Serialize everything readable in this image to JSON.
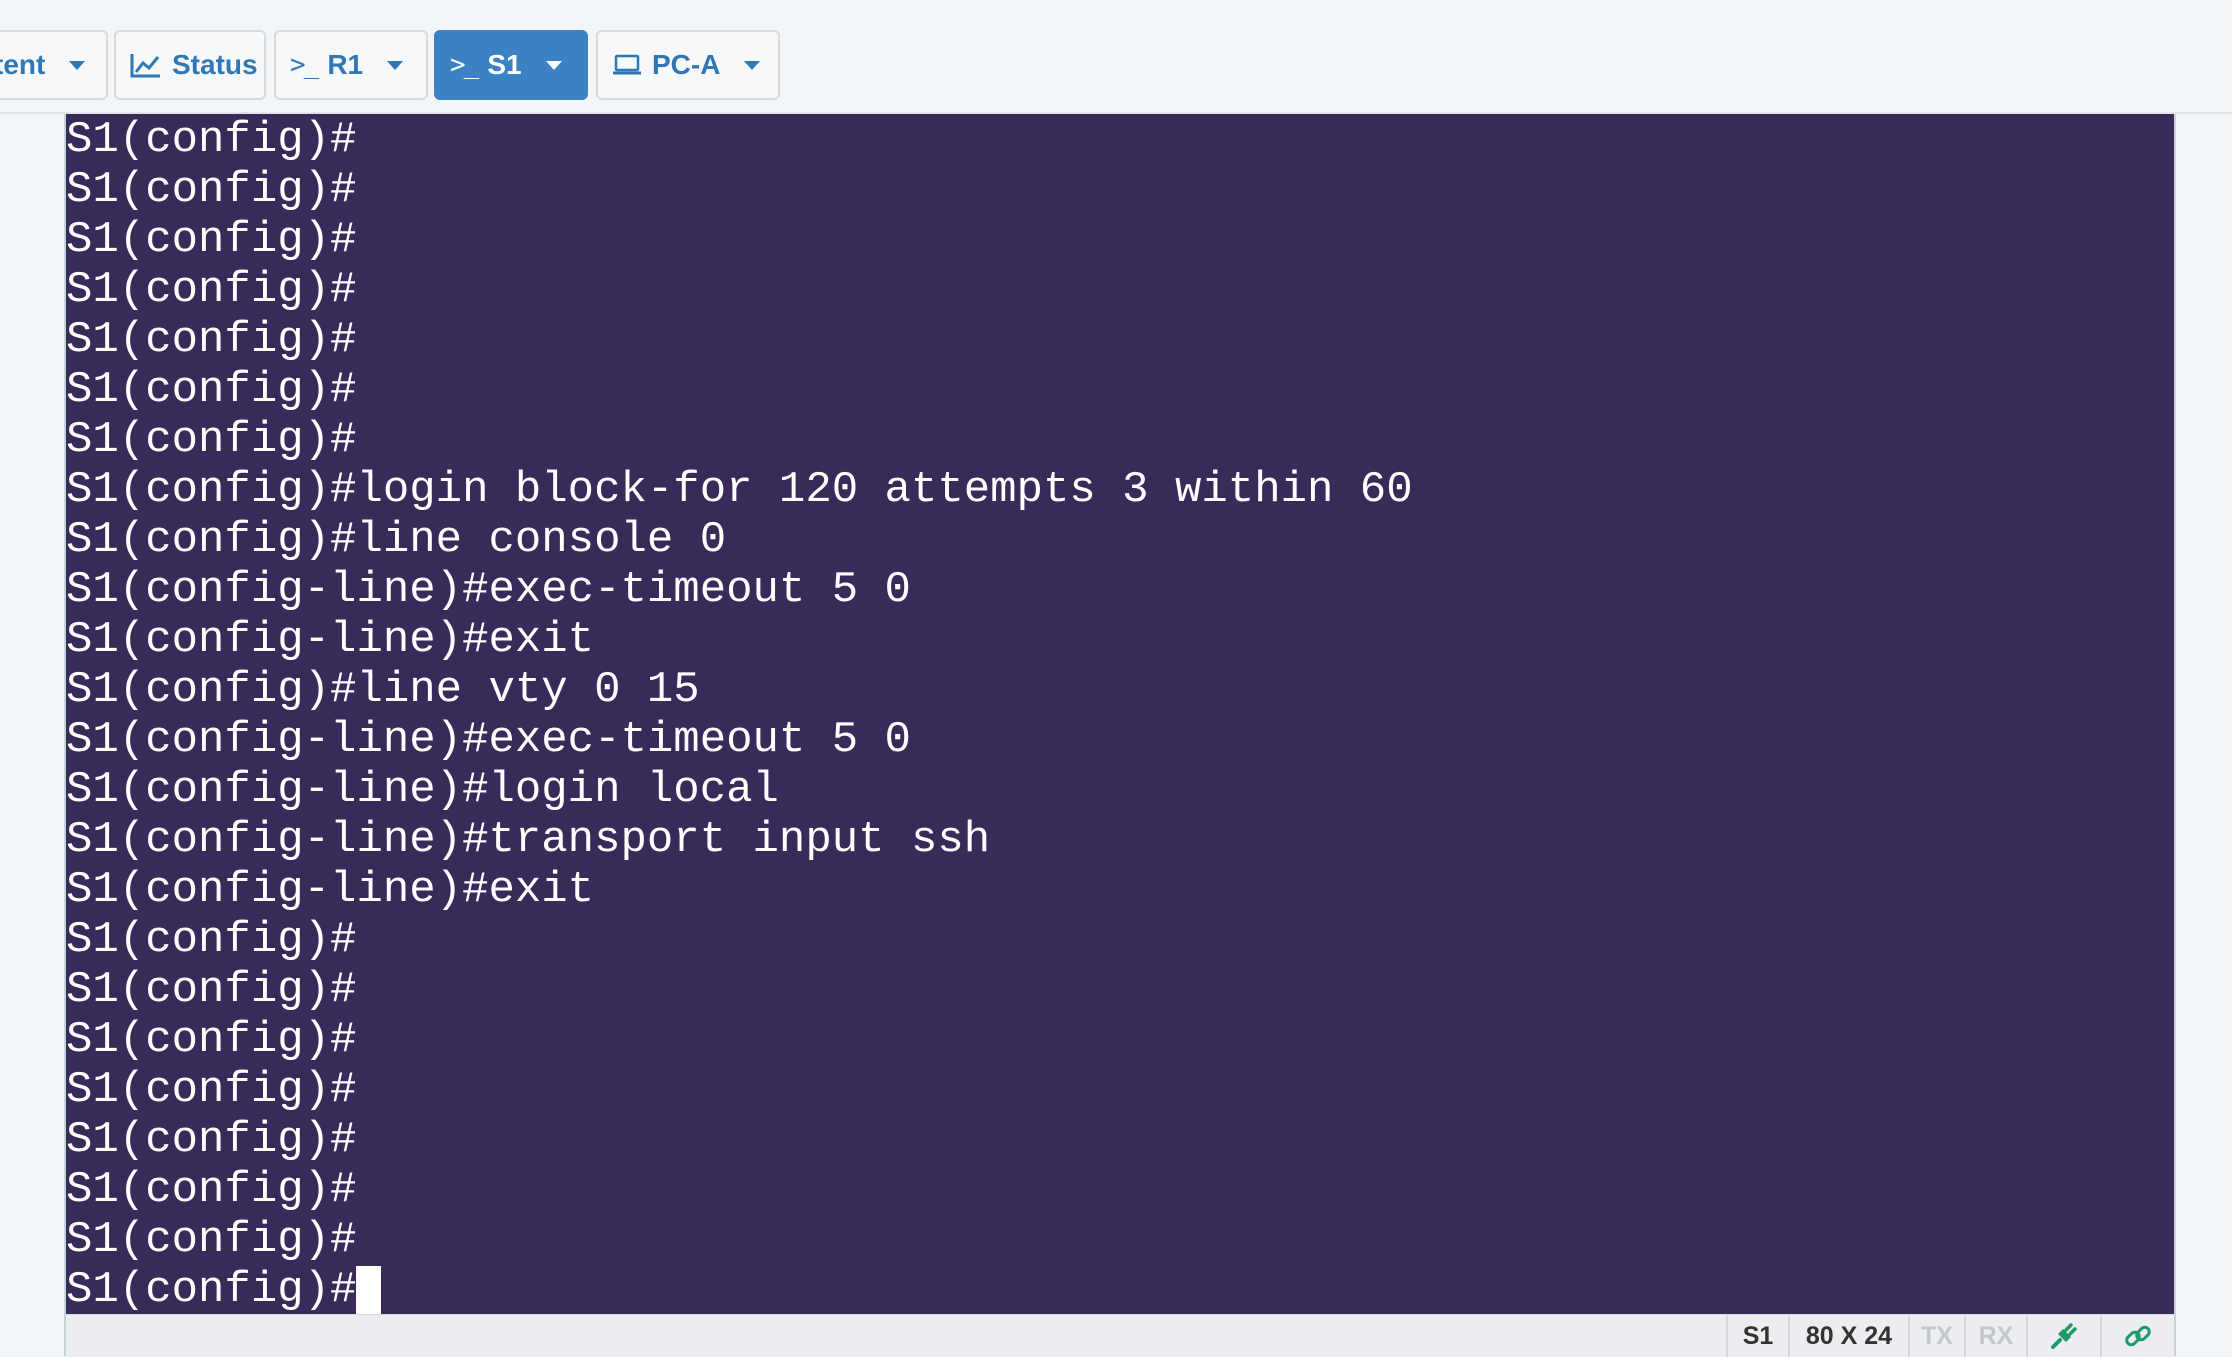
{
  "tabs": [
    {
      "label": "tent",
      "icon": "content-icon"
    },
    {
      "label": "Status",
      "icon": "chart-line-icon"
    },
    {
      "label": "R1",
      "icon": "terminal-prompt-icon"
    },
    {
      "label": "S1",
      "icon": "terminal-prompt-icon",
      "active": true
    },
    {
      "label": "PC-A",
      "icon": "laptop-icon"
    }
  ],
  "terminal": {
    "lines": [
      "S1(config)#",
      "S1(config)#",
      "S1(config)#",
      "S1(config)#",
      "S1(config)#",
      "S1(config)#",
      "S1(config)#",
      "S1(config)#login block-for 120 attempts 3 within 60",
      "S1(config)#line console 0",
      "S1(config-line)#exec-timeout 5 0",
      "S1(config-line)#exit",
      "S1(config)#line vty 0 15",
      "S1(config-line)#exec-timeout 5 0",
      "S1(config-line)#login local",
      "S1(config-line)#transport input ssh",
      "S1(config-line)#exit",
      "S1(config)#",
      "S1(config)#",
      "S1(config)#",
      "S1(config)#",
      "S1(config)#",
      "S1(config)#",
      "S1(config)#",
      "S1(config)#"
    ],
    "background": "#382a59",
    "foreground": "#ffffff"
  },
  "statusbar": {
    "device": "S1",
    "size": "80 X 24",
    "tx": "TX",
    "rx": "RX",
    "plug_icon": "plug-icon",
    "link_icon": "link-icon"
  },
  "colors": {
    "accent": "#3a82c4",
    "tab_text": "#2f77b5",
    "status_green": "#1e9a6a"
  }
}
